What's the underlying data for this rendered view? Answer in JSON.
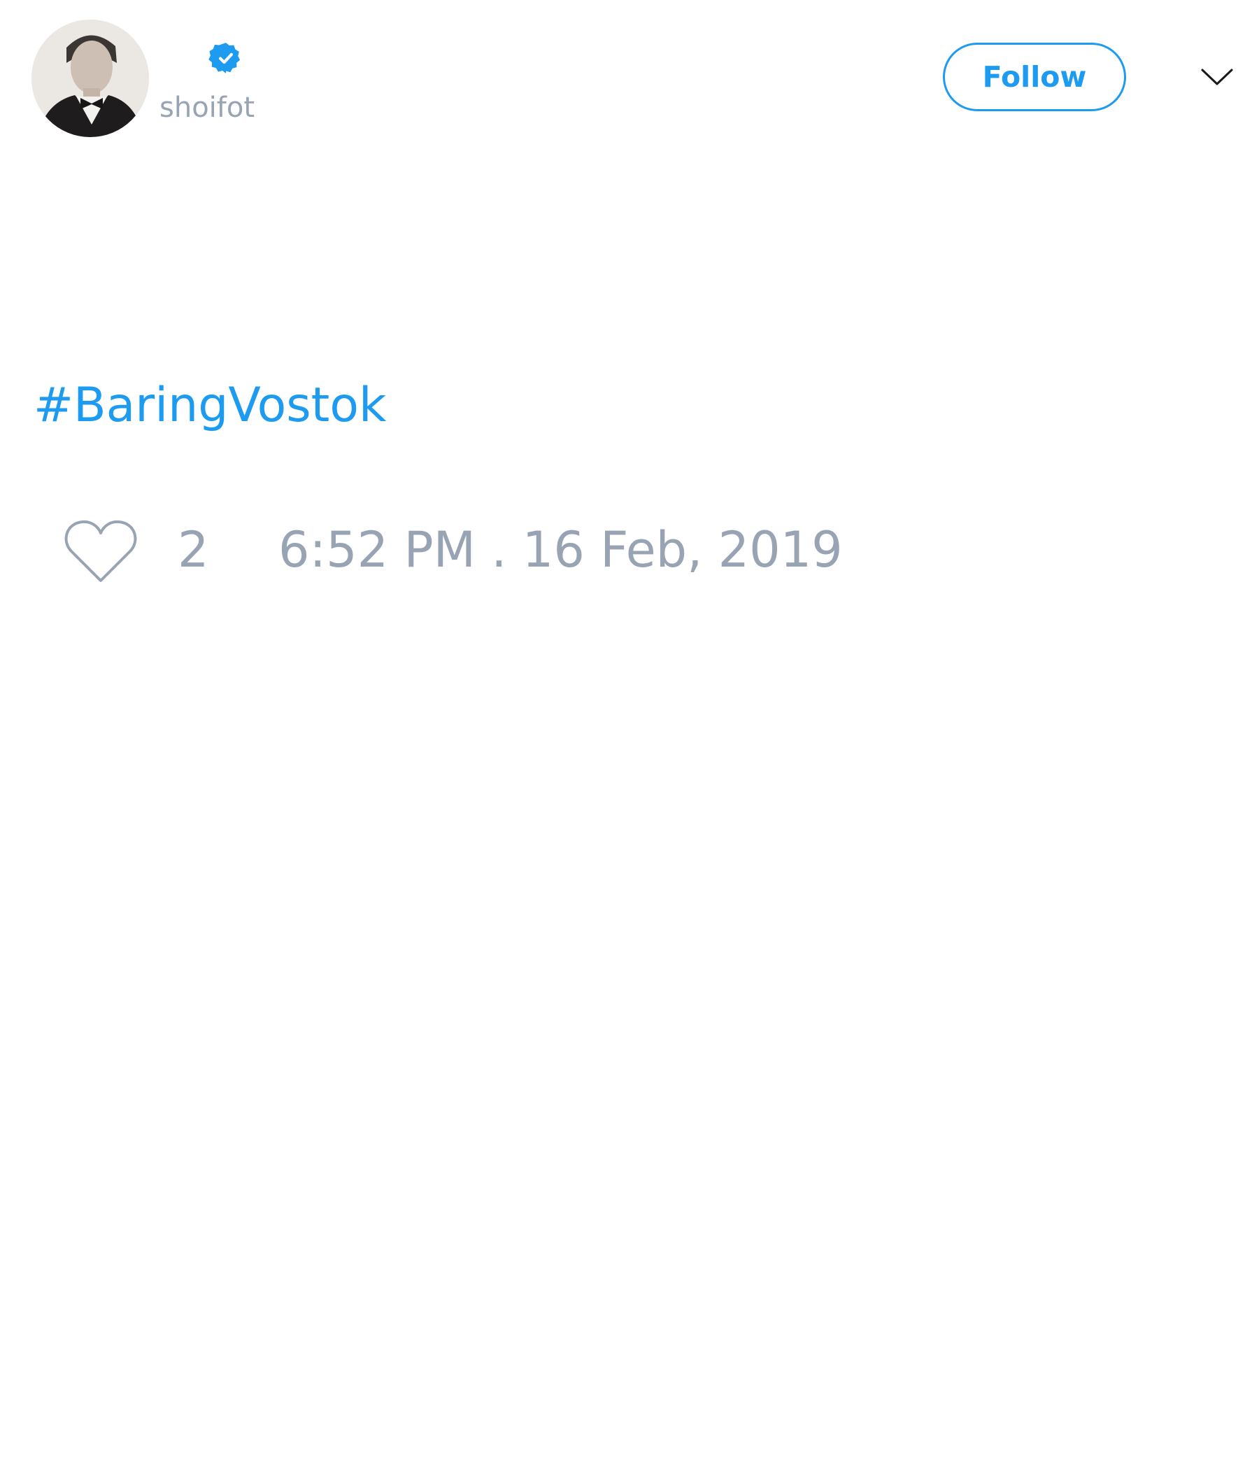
{
  "header": {
    "username": "shoifot",
    "follow_label": "Follow",
    "avatar_icon": "profile-photo",
    "verified_icon": "verified-badge-icon",
    "menu_icon": "chevron-down-icon"
  },
  "tweet": {
    "text": "#BaringVostok"
  },
  "footer": {
    "like_icon": "heart-icon",
    "like_count": "2",
    "timestamp": "6:52 PM . 16 Feb, 2019"
  },
  "colors": {
    "accent": "#1d9bf0",
    "muted": "#98a4b3",
    "background": "#ffffff"
  }
}
